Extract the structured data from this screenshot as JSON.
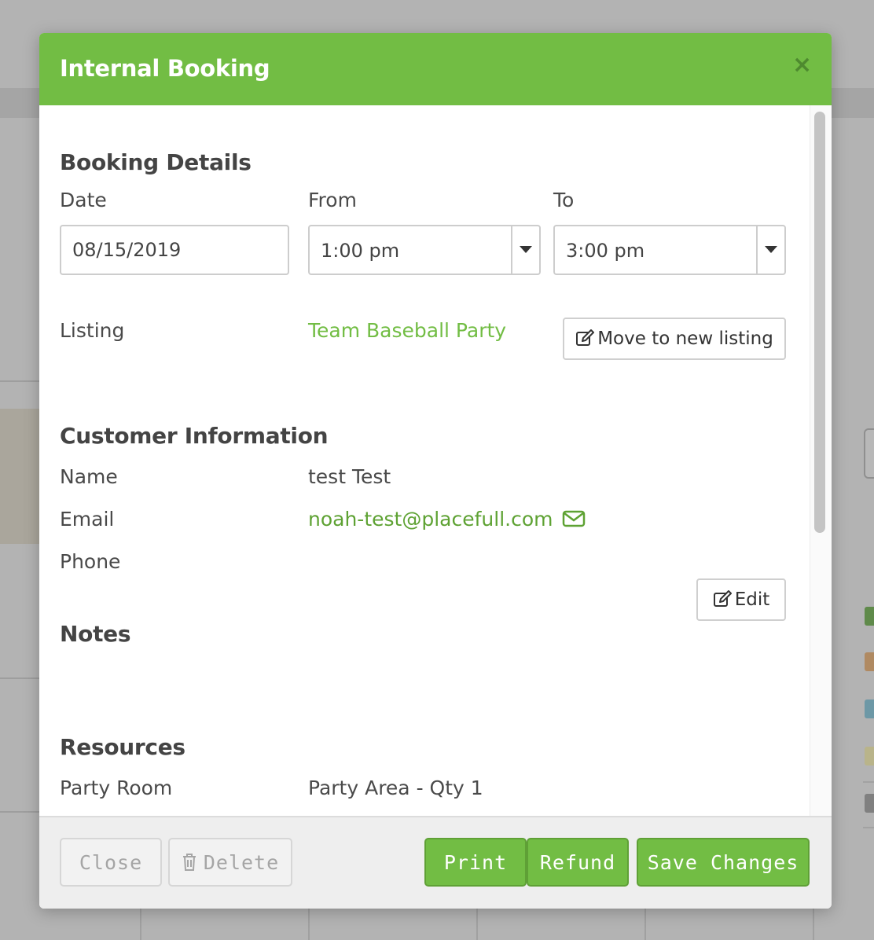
{
  "modal": {
    "title": "Internal Booking",
    "close_symbol": "×"
  },
  "booking_details": {
    "heading": "Booking Details",
    "date_label": "Date",
    "date_value": "08/15/2019",
    "from_label": "From",
    "from_value": "1:00 pm",
    "to_label": "To",
    "to_value": "3:00 pm",
    "listing_label": "Listing",
    "listing_value": "Team Baseball Party",
    "move_button": "Move to new listing"
  },
  "customer": {
    "heading": "Customer Information",
    "name_label": "Name",
    "name_value": "test Test",
    "email_label": "Email",
    "email_value": "noah-test@placefull.com",
    "phone_label": "Phone",
    "phone_value": ""
  },
  "notes": {
    "heading": "Notes",
    "edit_button": "Edit"
  },
  "resources": {
    "heading": "Resources",
    "item_label": "Party Room",
    "item_value": "Party Area - Qty 1"
  },
  "footer": {
    "close": "Close",
    "delete": "Delete",
    "print": "Print",
    "refund": "Refund",
    "save": "Save Changes"
  },
  "colors": {
    "accent": "#72bd44",
    "overlay": "#b3b3b3"
  }
}
